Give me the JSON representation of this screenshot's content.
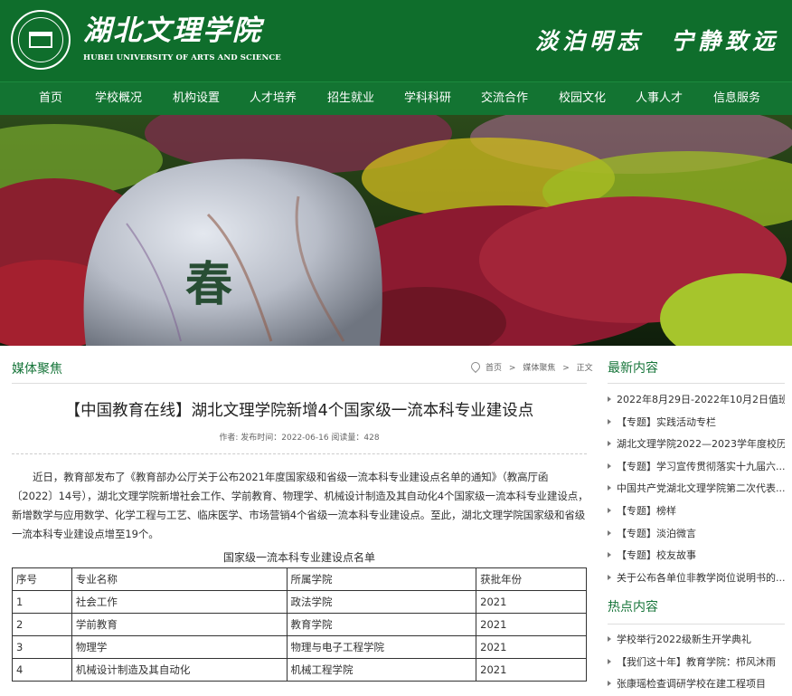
{
  "site": {
    "name_cn": "湖北文理学院",
    "name_en": "HUBEI UNIVERSITY OF ARTS AND SCIENCE",
    "motto": "淡泊明志　宁静致远",
    "banner_char": "春"
  },
  "nav": [
    "首页",
    "学校概况",
    "机构设置",
    "人才培养",
    "招生就业",
    "学科科研",
    "交流合作",
    "校园文化",
    "人事人才",
    "信息服务"
  ],
  "breadcrumb": {
    "section": "媒体聚焦",
    "home": "首页",
    "sep": ">",
    "cat": "媒体聚焦",
    "current": "正文"
  },
  "article": {
    "title": "【中国教育在线】湖北文理学院新增4个国家级一流本科专业建设点",
    "meta": "作者: 发布时间：2022-06-16 阅读量：428",
    "body": "近日，教育部发布了《教育部办公厅关于公布2021年度国家级和省级一流本科专业建设点名单的通知》（教高厅函〔2022〕14号），湖北文理学院新增社会工作、学前教育、物理学、机械设计制造及其自动化4个国家级一流本科专业建设点，新增数学与应用数学、化学工程与工艺、临床医学、市场营销4个省级一流本科专业建设点。至此，湖北文理学院国家级和省级一流本科专业建设点增至19个。",
    "table_caption": "国家级一流本科专业建设点名单",
    "table": {
      "headers": [
        "序号",
        "专业名称",
        "所属学院",
        "获批年份"
      ],
      "rows": [
        [
          "1",
          "社会工作",
          "政法学院",
          "2021"
        ],
        [
          "2",
          "学前教育",
          "教育学院",
          "2021"
        ],
        [
          "3",
          "物理学",
          "物理与电子工程学院",
          "2021"
        ],
        [
          "4",
          "机械设计制造及其自动化",
          "机械工程学院",
          "2021"
        ]
      ]
    }
  },
  "sidebar": {
    "latest_title": "最新内容",
    "latest": [
      "2022年8月29日-2022年10月2日值班...",
      "【专题】实践活动专栏",
      "湖北文理学院2022—2023学年度校历",
      "【专题】学习宣传贯彻落实十九届六...",
      "中国共产党湖北文理学院第二次代表...",
      "【专题】榜样",
      "【专题】淡泊微言",
      "【专题】校友故事",
      "关于公布各单位非教学岗位说明书的..."
    ],
    "hot_title": "热点内容",
    "hot": [
      "学校举行2022级新生开学典礼",
      "【我们这十年】教育学院：栉风沐雨",
      "张康瑶检查调研学校在建工程项目"
    ]
  },
  "colors": {
    "header_green": "#0f6e2c",
    "nav_green": "#137432",
    "accent_green": "#17753a"
  }
}
